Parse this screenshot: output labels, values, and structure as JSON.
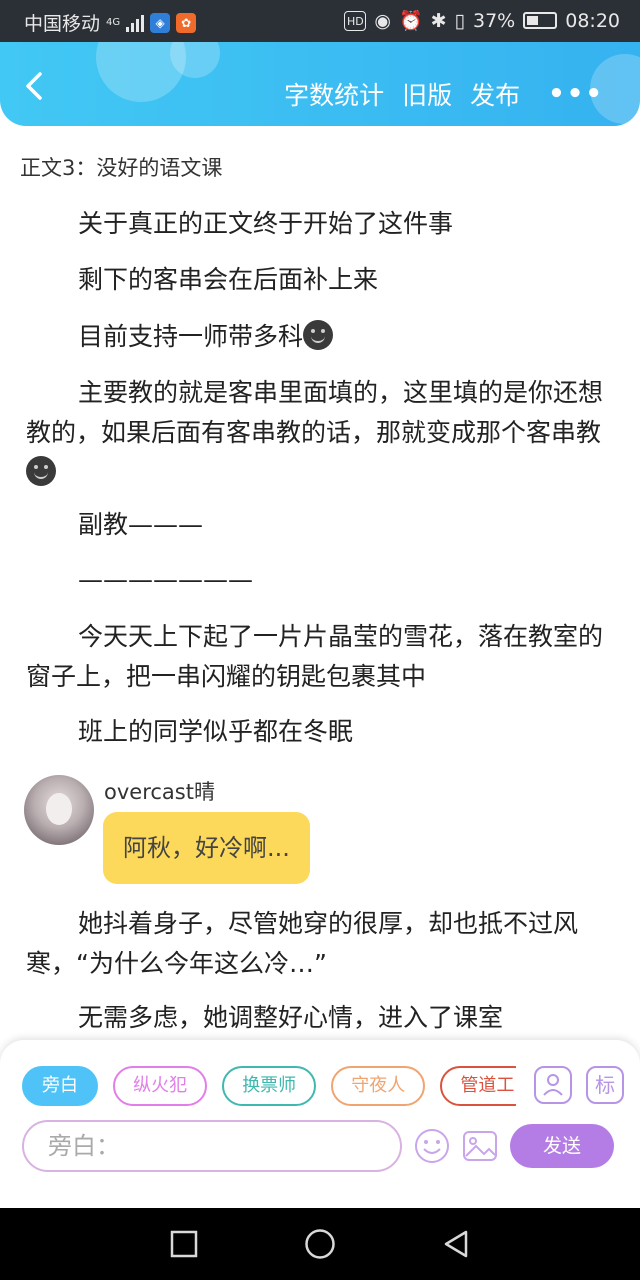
{
  "status_bar": {
    "carrier": "中国移动",
    "network": "4G",
    "battery": "37%",
    "time": "08:20",
    "icons": [
      "shield-app-icon",
      "app-badge-icon",
      "hd-icon",
      "eye-icon",
      "alarm-icon",
      "bluetooth-icon",
      "vibrate-icon",
      "battery-icon"
    ]
  },
  "header": {
    "actions": [
      "字数统计",
      "旧版",
      "发布"
    ],
    "more": "•••"
  },
  "chapter_title": "正文3：没好的语文课",
  "paragraphs": [
    "关于真正的正文终于开始了这件事",
    "剩下的客串会在后面补上来",
    "目前支持一师带多科",
    "主要教的就是客串里面填的，这里填的是你还想教的，如果后面有客串教的话，那就变成那个客串教",
    "副教———",
    "———————",
    "今天天上下起了一片片晶莹的雪花，落在教室的窗子上，把一串闪耀的钥匙包裹其中",
    "班上的同学似乎都在冬眠"
  ],
  "chat": {
    "name": "overcast晴",
    "message": "阿秋，好冷啊..."
  },
  "paragraphs_after": [
    "她抖着身子，尽管她穿的很厚，却也抵不过风寒，“为什么今年这么冷…”",
    "无需多虑，她调整好心情，进入了课室"
  ],
  "input_panel": {
    "roles": [
      {
        "label": "旁白",
        "color": "#4fc3f7",
        "active": true
      },
      {
        "label": "纵火犯",
        "color": "#e27ee9",
        "active": false
      },
      {
        "label": "换票师",
        "color": "#3fb8b0",
        "active": false
      },
      {
        "label": "守夜人",
        "color": "#f0a470",
        "active": false
      },
      {
        "label": "管道工",
        "color": "#d9533f",
        "active": false
      }
    ],
    "tool_buttons": [
      "标"
    ],
    "input_placeholder": "旁白：",
    "send_label": "发送"
  }
}
